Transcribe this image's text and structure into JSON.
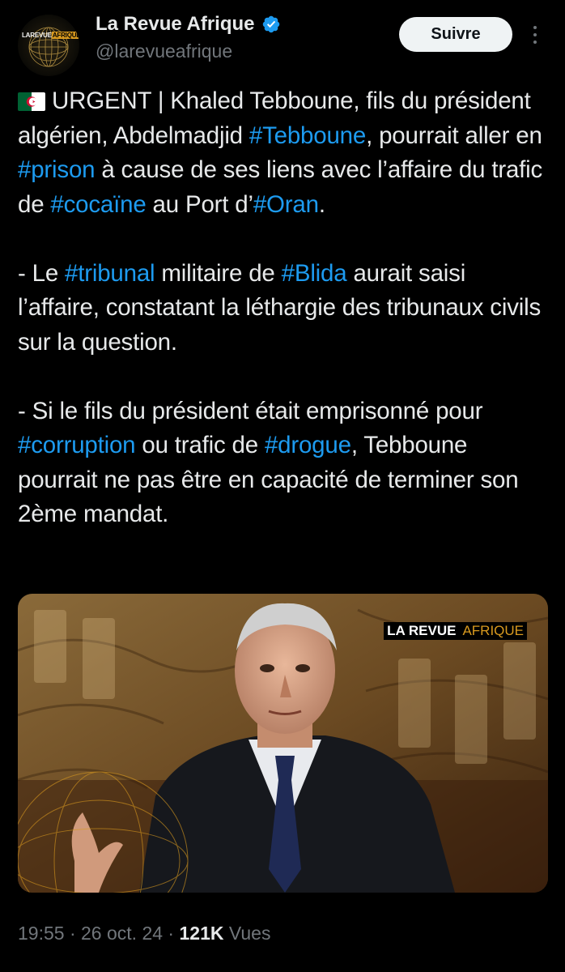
{
  "account": {
    "display_name": "La Revue Afrique",
    "handle": "@larevueafrique",
    "verified": true,
    "avatar_logo": {
      "part1": "LAREVUE",
      "part2": "AFRIQUE"
    },
    "follow_label": "Suivre"
  },
  "tweet": {
    "flag_emoji": "algeria-flag",
    "paragraph1": [
      {
        "text": "URGENT | Khaled Tebboune, fils du président algérien, Abdelmadjid "
      },
      {
        "text": "#Tebboune",
        "tag": true
      },
      {
        "text": ", pourrait aller en "
      },
      {
        "text": "#prison",
        "tag": true
      },
      {
        "text": " à cause de ses liens avec l’affaire du trafic de "
      },
      {
        "text": "#cocaïne",
        "tag": true
      },
      {
        "text": " au Port d’"
      },
      {
        "text": "#Oran",
        "tag": true
      },
      {
        "text": "."
      }
    ],
    "paragraph2": [
      {
        "text": "- Le "
      },
      {
        "text": "#tribunal",
        "tag": true
      },
      {
        "text": " militaire de "
      },
      {
        "text": "#Blida",
        "tag": true
      },
      {
        "text": " aurait saisi l’affaire, constatant la léthargie des tribunaux civils sur la question."
      }
    ],
    "paragraph3": [
      {
        "text": "- Si le fils du président était emprisonné pour "
      },
      {
        "text": "#corruption",
        "tag": true
      },
      {
        "text": " ou trafic de "
      },
      {
        "text": "#drogue",
        "tag": true
      },
      {
        "text": ", Tebboune pourrait ne pas être en capacité de terminer son 2ème mandat."
      }
    ],
    "media": {
      "watermark_part1": "LA REVUE",
      "watermark_part2": "AFRIQUE"
    },
    "meta": {
      "time": "19:55",
      "separator": " · ",
      "date": "26 oct. 24",
      "views_count": "121K",
      "views_label": "Vues"
    }
  },
  "colors": {
    "background": "#000000",
    "text": "#e7e9ea",
    "secondary": "#71767b",
    "hashtag": "#1d9bf0",
    "follow_bg": "#eff3f4",
    "verified": "#1d9bf0",
    "brand_gold": "#d99a1f"
  }
}
